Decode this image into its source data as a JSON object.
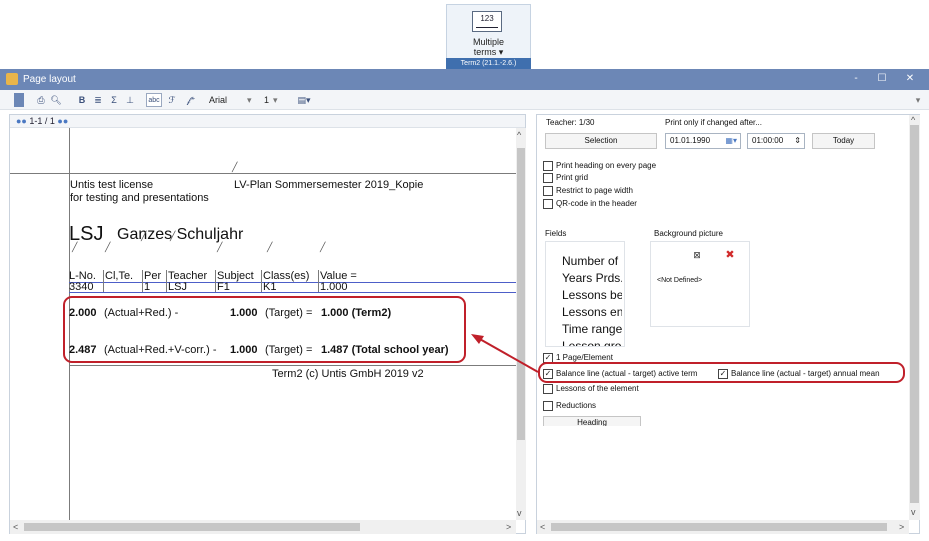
{
  "ribbon": {
    "multiple_terms_icon": "123",
    "multiple_terms_label_1": "Multiple",
    "multiple_terms_label_2": "terms ▾",
    "term_badge": "Term2 (21.1.-2.6.)"
  },
  "window": {
    "title": "Page layout",
    "controls": [
      "-",
      "☐",
      "✕"
    ]
  },
  "toolbar": {
    "font": "Arial",
    "font_size": "1",
    "icons": [
      "page-icon",
      "print-icon",
      "preview-icon",
      "bold-icon",
      "italic-icon",
      "sum-icon",
      "underline-icon",
      "abc-icon",
      "format-icon",
      "format-plus-icon"
    ]
  },
  "left_pane": {
    "header": "1-1 / 1",
    "report": {
      "license_line_1": "Untis test license",
      "license_line_2": "for testing and presentations",
      "plan_title": "LV-Plan  Sommersemester 2019_Kopie",
      "heading_code": "LSJ",
      "heading_text": "Ganzes Schuljahr",
      "columns": [
        "L-No.",
        "Cl,Te.",
        "Per",
        "Teacher",
        "Subject",
        "Class(es)",
        "Value ="
      ],
      "row": [
        "3340",
        "",
        "1",
        "LSJ",
        "F1",
        "K1",
        "1.000"
      ],
      "balance_term": {
        "actual": "2.000",
        "actual_label": "(Actual+Red.) -",
        "target": "1.000",
        "target_label": "(Target) =",
        "result": "1.000 (Term2)"
      },
      "balance_year": {
        "actual": "2.487",
        "actual_label": "(Actual+Red.+V-corr.) -",
        "target": "1.000",
        "target_label": "(Target) =",
        "result": "1.487 (Total school year)"
      },
      "footer": "Term2  (c) Untis GmbH 2019  v2"
    }
  },
  "right_pane": {
    "teacher_label": "Teacher: 1/30",
    "print_if_changed_label": "Print only if changed after...",
    "selection_button": "Selection",
    "date_value": "01.01.1990",
    "time_value": "01:00:00",
    "today_button": "Today",
    "options": [
      {
        "label": "Print heading on every page",
        "checked": false
      },
      {
        "label": "Print grid",
        "checked": false
      },
      {
        "label": "Restrict to page width",
        "checked": false
      },
      {
        "label": "QR-code in the header",
        "checked": false
      }
    ],
    "fields_label": "Fields",
    "fields": [
      "Number of u",
      "Years Prds.",
      "Lessons beg",
      "Lessons end",
      "Time range",
      "Lesson grou"
    ],
    "background_label": "Background picture",
    "not_defined": "<Not Defined>",
    "page_element": {
      "label": "1 Page/Element",
      "checked": true
    },
    "balance_active_term": {
      "label": "Balance line (actual - target) active term",
      "checked": true
    },
    "balance_annual_mean": {
      "label": "Balance line (actual - target) annual mean",
      "checked": true
    },
    "lessons_of_element": {
      "label": "Lessons of the element",
      "checked": false
    },
    "reductions": {
      "label": "Reductions",
      "checked": false
    },
    "heading_button": "Heading"
  },
  "colors": {
    "titlebar": "#6c87b6",
    "term_badge": "#3f6fae",
    "annotation": "#c0202a",
    "table_rule": "#4d5ec8"
  }
}
